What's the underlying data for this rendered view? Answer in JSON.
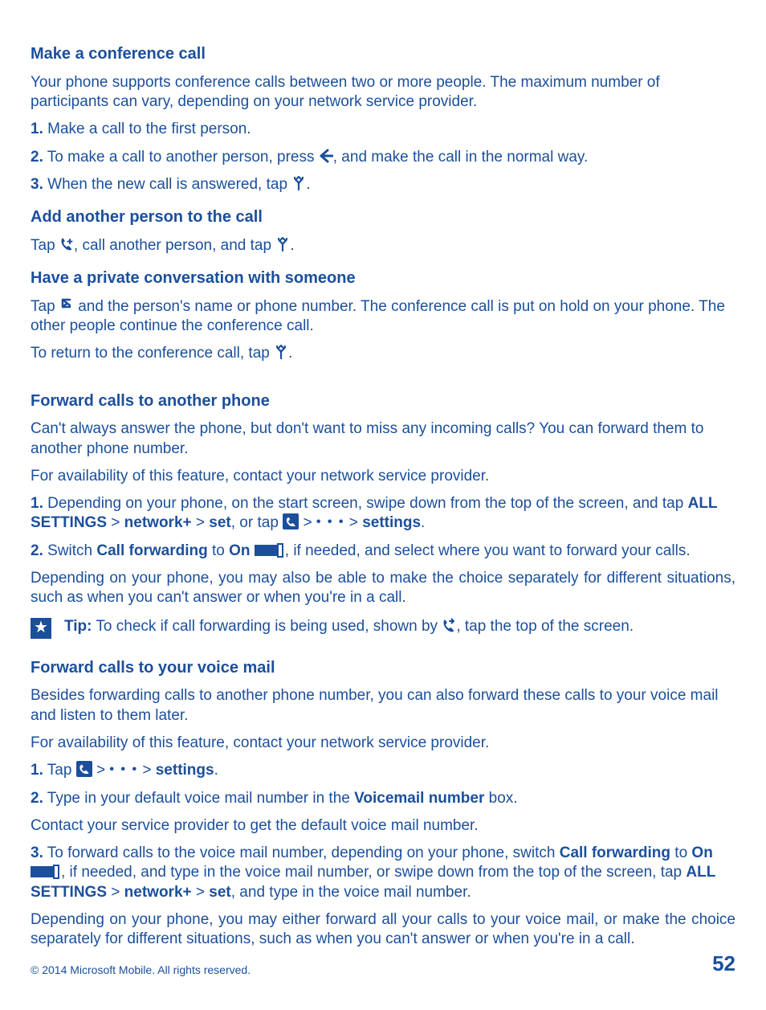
{
  "sec1": {
    "title": "Make a conference call",
    "intro": "Your phone supports conference calls between two or more people. The maximum number of participants can vary, depending on your network service provider.",
    "steps": {
      "n1": "1.",
      "t1": " Make a call to the first person.",
      "n2": "2.",
      "t2a": " To make a call to another person, press ",
      "t2b": ", and make the call in the normal way.",
      "n3": "3.",
      "t3a": " When the new call is answered, tap ",
      "t3b": "."
    },
    "sub1": {
      "title": "Add another person to the call",
      "body_a": "Tap ",
      "body_b": ", call another person, and tap ",
      "body_c": "."
    },
    "sub2": {
      "title": "Have a private conversation with someone",
      "body_a": "Tap ",
      "body_b": " and the person's name or phone number. The conference call is put on hold on your phone. The other people continue the conference call.",
      "ret_a": "To return to the conference call, tap ",
      "ret_b": "."
    }
  },
  "sec2": {
    "title": "Forward calls to another phone",
    "p1": "Can't always answer the phone, but don't want to miss any incoming calls? You can forward them to another phone number.",
    "p2": "For availability of this feature, contact your network service provider.",
    "s1": {
      "n": "1.",
      "a": " Depending on your phone, on the start screen, swipe down from the top of the screen, and tap ",
      "all": "ALL SETTINGS",
      "gt1": " > ",
      "net": "network+",
      "gt2": " > ",
      "set": "set",
      "b": ", or tap ",
      "gt3": " > ",
      "gt4": " > ",
      "settings": "settings",
      "c": "."
    },
    "s2": {
      "n": "2.",
      "a": " Switch ",
      "cf": "Call forwarding",
      "b": " to ",
      "on": "On",
      "sp": " ",
      "c": ", if needed, and select where you want to forward your calls."
    },
    "p3": "Depending on your phone, you may also be able to make the choice separately for different situations, such as when you can't answer or when you're in a call.",
    "tip": {
      "label": "Tip:",
      "a": " To check if call forwarding is being used, shown by ",
      "b": ", tap the top of the screen."
    }
  },
  "sec3": {
    "title": "Forward calls to your voice mail",
    "p1": "Besides forwarding calls to another phone number, you can also forward these calls to your voice mail and listen to them later.",
    "p2": "For availability of this feature, contact your network service provider.",
    "s1": {
      "n": "1.",
      "a": " Tap ",
      "gt1": " > ",
      "gt2": " > ",
      "settings": "settings",
      "b": "."
    },
    "s2": {
      "n": "2.",
      "a": " Type in your default voice mail number in the ",
      "vm": "Voicemail number",
      "b": " box."
    },
    "p3": "Contact your service provider to get the default voice mail number.",
    "s3": {
      "n": "3.",
      "a": " To forward calls to the voice mail number, depending on your phone, switch ",
      "cf": "Call forwarding",
      "b": " to ",
      "on": "On",
      "sp": " ",
      "c": ", if needed, and type in the voice mail number, or swipe down from the top of the screen, tap ",
      "all": "ALL SETTINGS",
      "gt1": " > ",
      "net": "network+",
      "gt2": " > ",
      "set": "set",
      "d": ", and type in the voice mail number."
    },
    "p4": "Depending on your phone, you may either forward all your calls to your voice mail, or make the choice separately for different situations, such as when you can't answer or when you're in a call."
  },
  "footer": {
    "copyright": "© 2014 Microsoft Mobile. All rights reserved.",
    "page": "52"
  },
  "icons": {
    "more": "• • •"
  }
}
